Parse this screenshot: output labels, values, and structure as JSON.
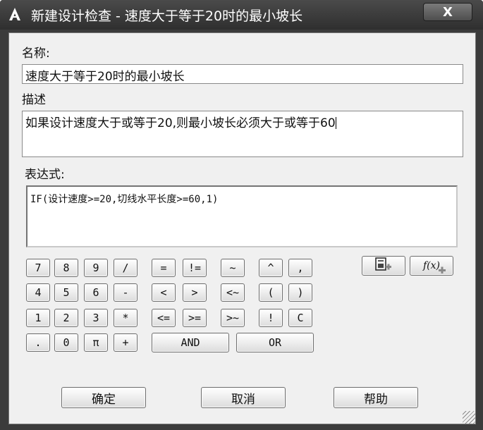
{
  "window": {
    "title": "新建设计检查 - 速度大于等于20时的最小坡长",
    "close_label": "X"
  },
  "form": {
    "name_label": "名称:",
    "name_value": "速度大于等于20时的最小坡长",
    "desc_label": "描述",
    "desc_value": "如果设计速度大于或等于20,则最小坡长必须大于或等于60",
    "expr_label": "表达式:",
    "expr_value": "IF(设计速度>=20,切线水平长度>=60,1)"
  },
  "keypad": {
    "row1": [
      "7",
      "8",
      "9",
      "/",
      "=",
      "!=",
      "~",
      "^",
      ","
    ],
    "row2": [
      "4",
      "5",
      "6",
      "-",
      "<",
      ">",
      "<~",
      "(",
      ")"
    ],
    "row3": [
      "1",
      "2",
      "3",
      "*",
      "<=",
      ">=",
      ">~",
      "!",
      "C"
    ],
    "row4": [
      ".",
      "0",
      "π",
      "+"
    ],
    "and_label": "AND",
    "or_label": "OR"
  },
  "tools": {
    "insert_property_icon": "property-insert-icon",
    "insert_function_icon": "function-insert-icon",
    "function_label": "f(x)"
  },
  "footer": {
    "ok_label": "确定",
    "cancel_label": "取消",
    "help_label": "帮助"
  }
}
